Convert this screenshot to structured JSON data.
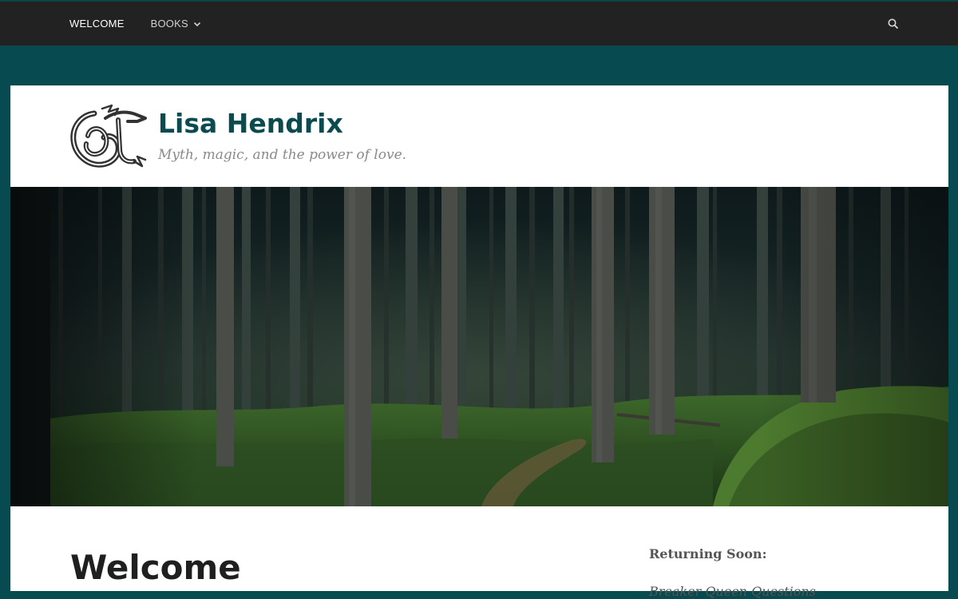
{
  "nav": {
    "items": [
      {
        "label": "WELCOME"
      },
      {
        "label": "BOOKS"
      }
    ]
  },
  "header": {
    "title": "Lisa Hendrix",
    "tagline": "Myth, magic, and the power of love."
  },
  "icons": {
    "search": "search-icon",
    "books_dropdown": "chevron-down-icon",
    "logo": "dragon-logo"
  },
  "main": {
    "heading": "Welcome"
  },
  "sidebar": {
    "widget_title": "Returning Soon:",
    "first_item": "Breaker Queen Questions"
  },
  "colors": {
    "background": "#074a4f",
    "topbar": "#222222",
    "title": "#0b4a4f",
    "tagline": "#8a8a8a"
  }
}
